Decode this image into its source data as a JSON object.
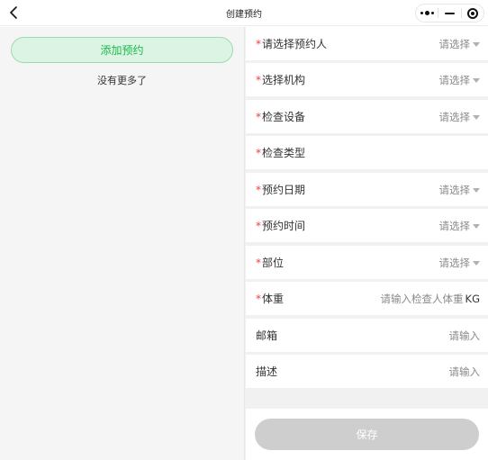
{
  "header": {
    "title": "创建预约"
  },
  "left_panel": {
    "add_button_label": "添加预约",
    "empty_text": "没有更多了"
  },
  "form": {
    "fields": [
      {
        "label": "请选择预约人",
        "required_mark": "*",
        "value": "请选择",
        "icon": "dropdown-caret-icon"
      },
      {
        "label": "选择机构",
        "required_mark": "*",
        "value": "请选择",
        "icon": "dropdown-caret-icon"
      },
      {
        "label": "检查设备",
        "required_mark": "*",
        "value": "请选择",
        "icon": "dropdown-caret-icon"
      },
      {
        "label": "检查类型",
        "required_mark": "*",
        "value": ""
      },
      {
        "label": "预约日期",
        "required_mark": "*",
        "value": "请选择",
        "icon": "dropdown-caret-icon"
      },
      {
        "label": "预约时间",
        "required_mark": "*",
        "value": "请选择",
        "icon": "dropdown-caret-icon"
      },
      {
        "label": "部位",
        "required_mark": "*",
        "value": "请选择",
        "icon": "dropdown-caret-icon"
      },
      {
        "label": "体重",
        "required_mark": "*",
        "placeholder": "请输入检查人体重",
        "unit": "KG"
      },
      {
        "label": "邮箱",
        "placeholder": "请输入"
      },
      {
        "label": "描述",
        "placeholder": "请输入"
      }
    ],
    "save_label": "保存"
  },
  "colors": {
    "accent_green": "#1db84c",
    "required_red": "#e64340",
    "save_disabled": "#cecece"
  }
}
